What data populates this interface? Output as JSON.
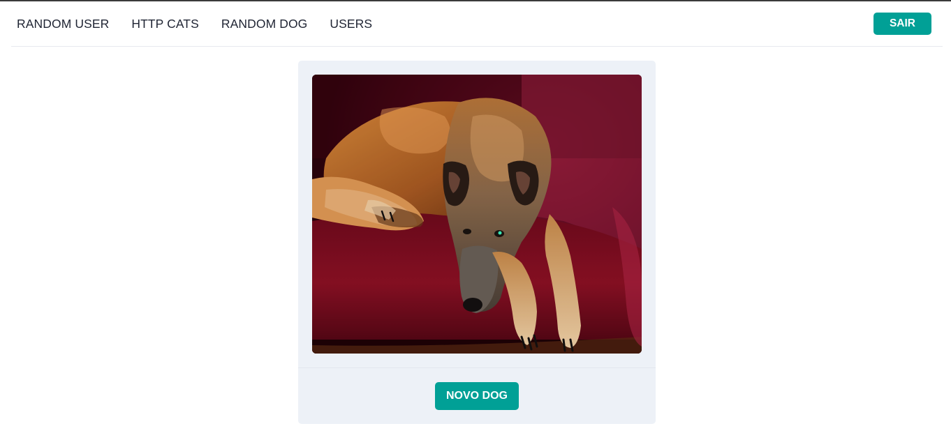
{
  "navbar": {
    "links": [
      {
        "label": "RANDOM USER"
      },
      {
        "label": "HTTP CATS"
      },
      {
        "label": "RANDOM DOG"
      },
      {
        "label": "USERS"
      }
    ],
    "logout_label": "SAIR"
  },
  "card": {
    "image_alt": "random-dog-photo",
    "new_dog_label": "NOVO DOG"
  },
  "colors": {
    "accent": "#01a096",
    "card_background": "#edf1f7",
    "text": "#1f2433"
  }
}
